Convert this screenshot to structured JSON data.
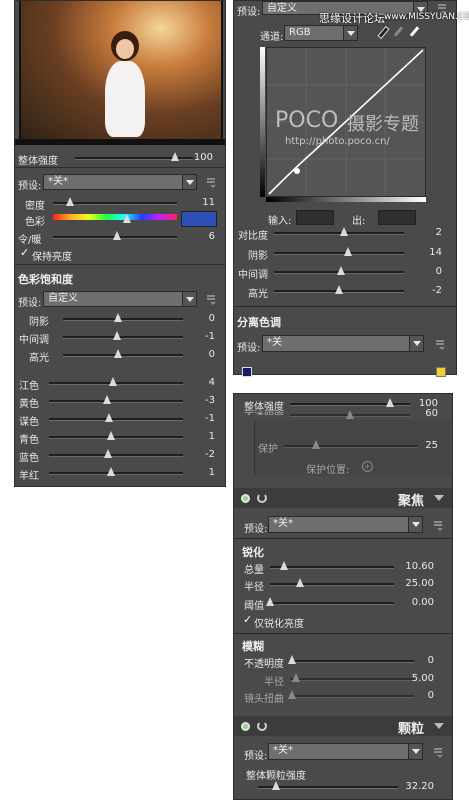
{
  "panel1": {
    "strength_label": "整体强度",
    "strength_value": "100",
    "preset_label": "预设:",
    "preset_value": "*关*",
    "density_label": "密度",
    "density_value": "11",
    "color_label": "色彩",
    "color_swatch": "#2f4fb8",
    "warmcool_label": "令/暖",
    "warmcool_value": "6",
    "preserve_label": "保持亮度",
    "section_title": "色彩饱和度",
    "preset2_label": "预设:",
    "preset2_value": "自定义",
    "tone_rows": [
      {
        "label": "阴影",
        "value": "0"
      },
      {
        "label": "中间调",
        "value": "-1"
      },
      {
        "label": "高光",
        "value": "0"
      }
    ],
    "color_rows": [
      {
        "label": "江色",
        "value": "4"
      },
      {
        "label": "黄色",
        "value": "-3"
      },
      {
        "label": "谋色",
        "value": "-1"
      },
      {
        "label": "青色",
        "value": "1"
      },
      {
        "label": "蓝色",
        "value": "-2"
      },
      {
        "label": "羊红",
        "value": "1"
      }
    ]
  },
  "panel2": {
    "preset_label": "预设:",
    "preset_value": "自定义",
    "watermark_site": "思缘设计论坛",
    "watermark_url": "www.MISSYUAN.COM",
    "channel_label": "通道:",
    "channel_value": "RGB",
    "poco_brand": "POCO",
    "poco_tagline": "摄影专题",
    "poco_url": "http://photo.poco.cn/",
    "input_label": "输入:",
    "output_label": "出:",
    "rows": [
      {
        "label": "对比度",
        "value": "2"
      },
      {
        "label": "阴影",
        "value": "14"
      },
      {
        "label": "中间调",
        "value": "0"
      },
      {
        "label": "高光",
        "value": "-2"
      }
    ],
    "section_title": "分离色调",
    "preset2_label": "预设:",
    "preset2_value": "*关",
    "shadow_swatch": "#1a1a6a",
    "highlight_swatch": "#f0d030"
  },
  "panel3": {
    "strength_label": "整体强度",
    "strength_value": "100",
    "opacity_partial": "不透明度",
    "opacity_partial_value": "60",
    "protect_label": "保护",
    "protect_value": "25",
    "protect_pos_label": "保护位置:",
    "focus_title": "聚焦",
    "preset_label": "预设:",
    "preset_value": "*关*",
    "sharpen_title": "锐化",
    "sharpen_rows": [
      {
        "label": "总量",
        "value": "10.60"
      },
      {
        "label": "半径",
        "value": "25.00"
      },
      {
        "label": "阈值",
        "value": "0.00"
      }
    ],
    "sharpen_lum_label": "仅锐化亮度",
    "blur_title": "模糊",
    "blur_rows": [
      {
        "label": "不透明度",
        "value": "0"
      },
      {
        "label": "半径",
        "value": "5.00"
      },
      {
        "label": "镜头扭曲",
        "value": "0"
      }
    ],
    "grain_title": "颗粒",
    "preset2_label": "预设:",
    "preset2_value": "*关*",
    "grain_strength_label": "整体颗粒强度",
    "grain_strength_value": "32.20"
  }
}
